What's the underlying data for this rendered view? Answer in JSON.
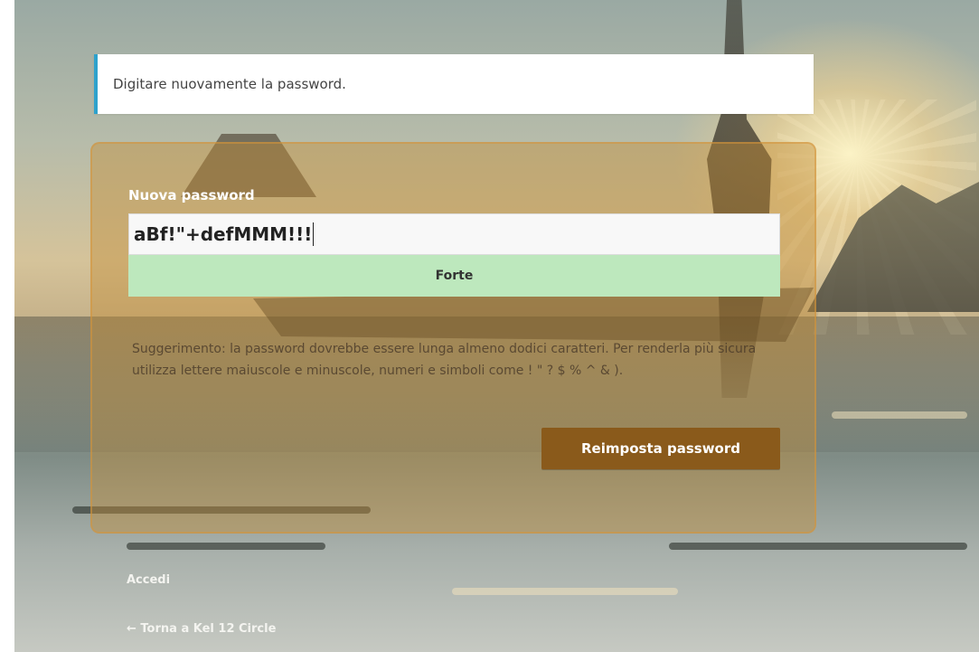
{
  "notice": {
    "message": "Digitare nuovamente la password.",
    "accent_color": "#2ea2cc"
  },
  "form": {
    "new_password_label": "Nuova password",
    "password_value": "aBf!\"+defMMM!!!",
    "strength_text": "Forte",
    "strength_color": "#bde8bd",
    "hint": "Suggerimento: la password dovrebbe essere lunga almeno dodici caratteri. Per renderla più sicura utilizza lettere maiuscole e minuscole, numeri e simboli come ! \" ? $ % ^ & ).",
    "submit_label": "Reimposta password",
    "submit_color": "#8a5a1b"
  },
  "links": {
    "login": "Accedi",
    "back_to_site": "← Torna a Kel 12 Circle"
  },
  "background": {
    "image_description_icon": "sunset-lake-photo"
  }
}
